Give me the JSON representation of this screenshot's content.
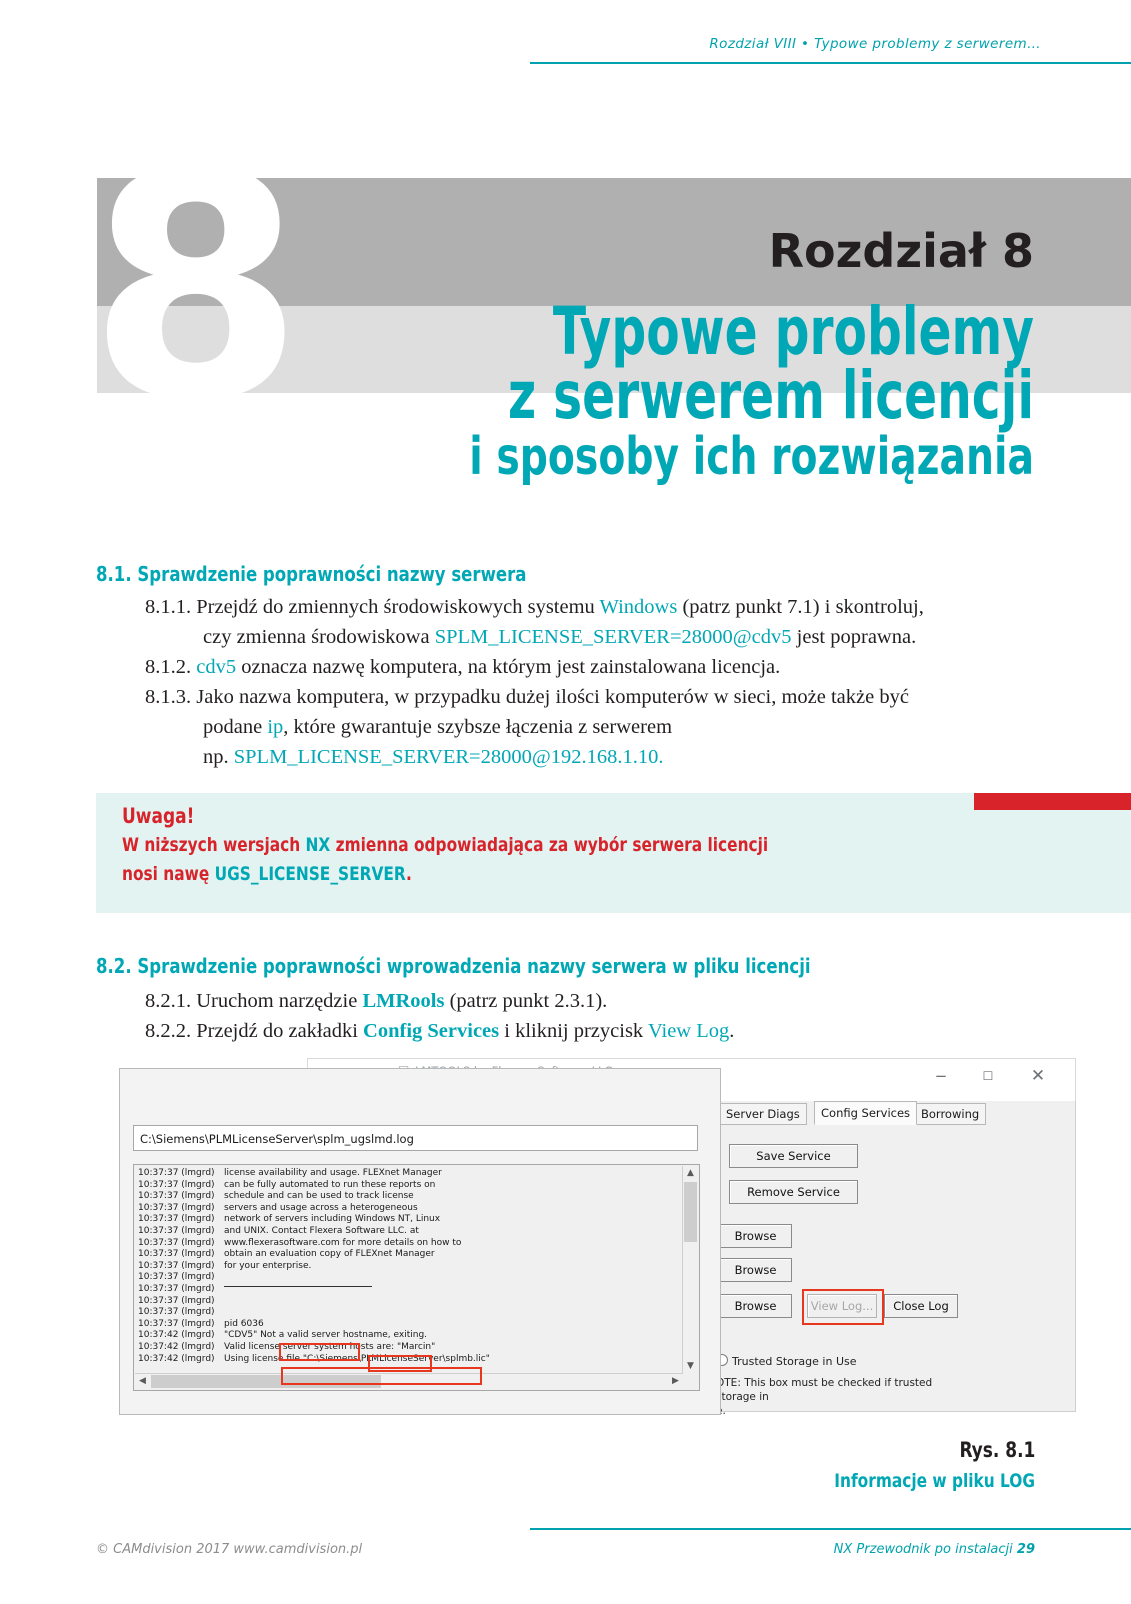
{
  "header": {
    "running_head": "Rozdział VIII • Typowe problemy z serwerem…"
  },
  "banner": {
    "big_number": "8",
    "chapter_label": "Rozdział 8",
    "title_line1": "Typowe problemy",
    "title_line2": "z serwerem licencji",
    "title_line3": "i sposoby ich rozwiązania",
    "accent_color": "#00a7b5",
    "band_dark": "#b0b0b0",
    "band_light": "#dedede"
  },
  "sections": {
    "s81_heading": "8.1. Sprawdzenie poprawności nazwy serwera",
    "s82_heading": "8.2. Sprawdzenie poprawności wprowadzenia nazwy serwera w pliku licencji",
    "p811": {
      "num": "8.1.1.",
      "t1": " Przejdź do zmiennych środowiskowych systemu ",
      "q1": "Windows",
      "t2": " (patrz punkt 7.1) i skontroluj,",
      "t3": "czy zmienna środowiskowa ",
      "q2": "SPLM_LICENSE_SERVER=28000@cdv5",
      "t4": " jest poprawna."
    },
    "p812": {
      "num": "8.1.2.",
      "q1": " cdv5",
      "t1": " oznacza nazwę komputera, na którym jest zainstalowana licencja."
    },
    "p813": {
      "num": "8.1.3.",
      "t1": " Jako nazwa komputera, w przypadku dużej ilości komputerów w sieci, może także być",
      "t2": "podane ",
      "q1": "ip",
      "t3": ", które gwarantuje szybsze łączenia z serwerem",
      "t4": "np. ",
      "q2": "SPLM_LICENSE_SERVER=28000@192.168.1.10."
    },
    "p821": {
      "num": "8.2.1.",
      "t1": " Uruchom narzędzie ",
      "q1": "LMRools",
      "t2": " (patrz punkt 2.3.1)."
    },
    "p822": {
      "num": "8.2.2.",
      "t1": " Przejdź do zakładki ",
      "q1": "Config Services",
      "t2": " i kliknij przycisk ",
      "q2": "View Log",
      "t3": "."
    }
  },
  "warning": {
    "title": "Uwaga!",
    "l1_a": "W niższych wersjach ",
    "l1_q": "NX",
    "l1_b": " zmienna odpowiadająca za wybór serwera licencji",
    "l2_a": "nosi nawę ",
    "l2_q": "UGS_LICENSE_SERVER",
    "l2_b": ".",
    "bg_color": "#e2f3f2",
    "text_color": "#d8232a",
    "bar_color": "#d8232a"
  },
  "lmtools": {
    "window_title": "LMTOOLS by Flexera Software LLC",
    "app_icon": "lmtools-app-icon",
    "minimize": "−",
    "maximize": "☐",
    "close": "✕",
    "tabs": [
      {
        "label": "Server Diags",
        "active": false
      },
      {
        "label": "Config Services",
        "active": true
      },
      {
        "label": "Borrowing",
        "active": false
      }
    ],
    "log_path": "C:\\Siemens\\PLMLicenseServer\\splm_ugslmd.log",
    "log_lines": [
      {
        "ts": "10:37:37 (lmgrd)",
        "msg": "license availability and usage. FLEXnet Manager"
      },
      {
        "ts": "10:37:37 (lmgrd)",
        "msg": "can be fully automated to run these reports on"
      },
      {
        "ts": "10:37:37 (lmgrd)",
        "msg": "schedule and can be used to track license"
      },
      {
        "ts": "10:37:37 (lmgrd)",
        "msg": "servers and usage across a heterogeneous"
      },
      {
        "ts": "10:37:37 (lmgrd)",
        "msg": "network of servers including Windows NT, Linux"
      },
      {
        "ts": "10:37:37 (lmgrd)",
        "msg": "and UNIX. Contact Flexera Software LLC. at"
      },
      {
        "ts": "10:37:37 (lmgrd)",
        "msg": "www.flexerasoftware.com for more details on how to"
      },
      {
        "ts": "10:37:37 (lmgrd)",
        "msg": "obtain an evaluation copy of FLEXnet Manager"
      },
      {
        "ts": "10:37:37 (lmgrd)",
        "msg": "for your enterprise."
      },
      {
        "ts": "10:37:37 (lmgrd)",
        "msg": ""
      },
      {
        "ts": "10:37:37 (lmgrd)",
        "msg": "__RULE__"
      },
      {
        "ts": "10:37:37 (lmgrd)",
        "msg": ""
      },
      {
        "ts": "10:37:37 (lmgrd)",
        "msg": ""
      },
      {
        "ts": "10:37:37 (lmgrd)",
        "msg": "pid 6036"
      },
      {
        "ts": "10:37:42 (lmgrd)",
        "msg": "\"CDV5\" Not a valid server hostname, exiting."
      },
      {
        "ts": "10:37:42 (lmgrd)",
        "msg": "Valid license server system hosts are: \"Marcin\""
      },
      {
        "ts": "10:37:42 (lmgrd)",
        "msg": "Using license file \"C:\\Siemens\\PLMLicenseServer\\splmb.lic\""
      }
    ],
    "buttons": {
      "save_service": "Save Service",
      "remove_service": "Remove Service",
      "browse_1": "Browse",
      "browse_2": "Browse",
      "browse_3": "Browse",
      "view_log": "View Log...",
      "close_log": "Close Log"
    },
    "trusted_storage_label": "Trusted Storage in Use",
    "note_text": "OTE: This box must be checked if trusted storage in\ne.",
    "annotation_color": "#e8371f"
  },
  "caption": {
    "figure": "Rys. 8.1",
    "description": "Informacje w pliku LOG"
  },
  "footer": {
    "left": "© CAMdivision 2017 www.camdivision.pl",
    "right_text": "NX Przewodnik po instalacji ",
    "page_number": "29"
  }
}
